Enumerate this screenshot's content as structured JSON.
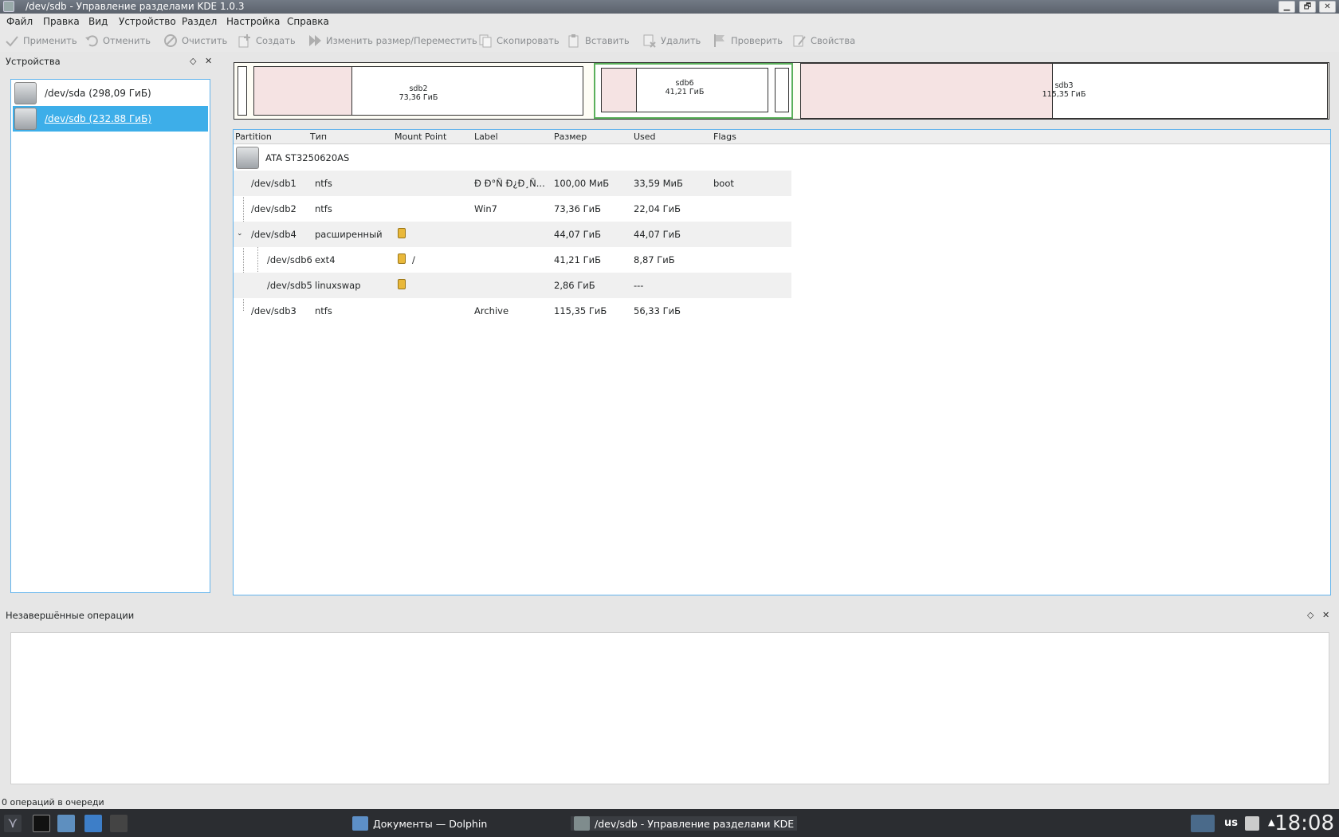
{
  "window": {
    "title": "/dev/sdb - Управление разделами KDE 1.0.3",
    "buttons": {
      "minimize": "▁",
      "restore": "🗗",
      "close": "✕"
    }
  },
  "menu": [
    "Файл",
    "Правка",
    "Вид",
    "Устройство",
    "Раздел",
    "Настройка",
    "Справка"
  ],
  "toolbar": {
    "apply": "Применить",
    "undo": "Отменить",
    "clear": "Очистить",
    "create": "Создать",
    "resize": "Изменить размер/Переместить",
    "copy": "Скопировать",
    "paste": "Вставить",
    "delete": "Удалить",
    "check": "Проверить",
    "properties": "Свойства"
  },
  "devices_dock": {
    "title": "Устройства",
    "float": "◇",
    "close": "✕",
    "items": [
      {
        "label": "/dev/sda (298,09 ГиБ)"
      },
      {
        "label": "/dev/sdb (232.88 ГиБ)"
      }
    ]
  },
  "diskmap": {
    "sdb2": {
      "name": "sdb2",
      "size": "73,36 ГиБ"
    },
    "sdb6": {
      "name": "sdb6",
      "size": "41,21 ГиБ"
    },
    "sdb3": {
      "name": "sdb3",
      "size": "115,35 ГиБ"
    }
  },
  "table": {
    "headers": [
      "Partition",
      "Тип",
      "Mount Point",
      "Label",
      "Размер",
      "Used",
      "Flags"
    ],
    "device": "ATA ST3250620AS",
    "rows": [
      {
        "partition": "/dev/sdb1",
        "type": "ntfs",
        "mount": "",
        "label": "Ð Ð°Ñ Ð¿Ð¸Ñ...",
        "size": "100,00 МиБ",
        "used": "33,59 МиБ",
        "flags": "boot"
      },
      {
        "partition": "/dev/sdb2",
        "type": "ntfs",
        "mount": "",
        "label": "Win7",
        "size": "73,36 ГиБ",
        "used": "22,04 ГиБ",
        "flags": ""
      },
      {
        "partition": "/dev/sdb4",
        "type": "расширенный",
        "mount": "",
        "label": "",
        "size": "44,07 ГиБ",
        "used": "44,07 ГиБ",
        "flags": ""
      },
      {
        "partition": "/dev/sdb6",
        "type": "ext4",
        "mount": "/",
        "label": "",
        "size": "41,21 ГиБ",
        "used": "8,87 ГиБ",
        "flags": ""
      },
      {
        "partition": "/dev/sdb5",
        "type": "linuxswap",
        "mount": "",
        "label": "",
        "size": "2,86 ГиБ",
        "used": "---",
        "flags": ""
      },
      {
        "partition": "/dev/sdb3",
        "type": "ntfs",
        "mount": "",
        "label": "Archive",
        "size": "115,35 ГиБ",
        "used": "56,33 ГиБ",
        "flags": ""
      }
    ]
  },
  "pending_dock": {
    "title": "Незавершённые операции",
    "float": "◇",
    "close": "✕"
  },
  "status": "0 операций в очереди",
  "taskbar": {
    "tasks": [
      "Документы — Dolphin",
      "/dev/sdb - Управление разделами KDE"
    ],
    "keyboard": "us",
    "clock": "18:08"
  }
}
